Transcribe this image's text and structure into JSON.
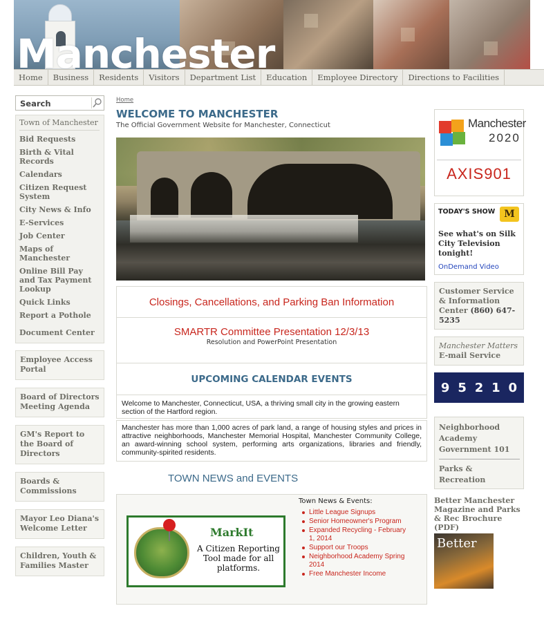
{
  "header": {
    "site_title": "Manchester"
  },
  "nav": {
    "items": [
      "Home",
      "Business",
      "Residents",
      "Visitors",
      "Department List",
      "Education",
      "Employee Directory",
      "Directions to Facilities"
    ]
  },
  "left": {
    "search_label": "Search",
    "links": [
      "Town of Manchester",
      "Bid Requests",
      "Birth & Vital Records",
      "Calendars",
      "Citizen Request System",
      "City News & Info",
      "E-Services",
      "Job Center",
      "Maps of Manchester",
      "Online Bill Pay and Tax Payment Lookup",
      "Quick Links",
      "Report a Pothole"
    ],
    "document_center": "Document Center",
    "boxes": [
      "Employee Access Portal",
      "Board of Directors Meeting Agenda",
      "GM's Report to the Board of Directors",
      "Boards & Commissions",
      "Mayor Leo Diana's Welcome Letter",
      "Children, Youth & Families Master"
    ]
  },
  "main": {
    "breadcrumb": "Home",
    "title": "WELCOME TO MANCHESTER",
    "subtitle": "The Official Government Website for Manchester, Connecticut",
    "closings": "Closings, Cancellations, and Parking Ban Information",
    "smartr_title": "SMARTR Committee Presentation 12/3/13",
    "smartr_sub": "Resolution and PowerPoint Presentation",
    "upcoming": "UPCOMING CALENDAR EVENTS",
    "intro1": "Welcome to Manchester, Connecticut, USA, a thriving small city in the growing eastern section of the Hartford region.",
    "intro2": "Manchester has more than 1,000 acres of park land, a range of housing styles and prices in attractive neighborhoods, Manchester Memorial Hospital, Manchester Community College, an award-winning school system, performing arts organizations, libraries and friendly, community-spirited residents.",
    "news_heading": "TOWN NEWS and EVENTS",
    "markit_name": "MarkIt",
    "markit_desc": "A Citizen Reporting Tool made for all platforms.",
    "news_list_title": "Town News & Events:",
    "news_items": [
      "Little League Signups",
      "Senior Homeowner's Program",
      "Expanded Recycling - February 1, 2014",
      "Support our Troops",
      "Neighborhood Academy Spring 2014",
      "Free Manchester Income"
    ]
  },
  "right": {
    "m2020_line1": "Manchester",
    "m2020_line2": "2020",
    "axis": "AXIS901",
    "today_head": "TODAY'S SHOW",
    "today_badge": "M",
    "today_text": "See what's on Silk City Television tonight!",
    "today_link": "OnDemand Video",
    "cs_text": "Customer Service & Information Center",
    "cs_phone": "(860) 647-5235",
    "mm_italic": "Manchester Matters",
    "mm_rest": " E-mail Service",
    "tile_digits": [
      "9",
      "5",
      "2",
      "1",
      "0"
    ],
    "nbh1": "Neighborhood Academy",
    "nbh2": "Government 101",
    "nbh3": "Parks & Recreation",
    "better": "Better Manchester Magazine and Parks & Rec Brochure (PDF)",
    "mag_title": "Better"
  }
}
